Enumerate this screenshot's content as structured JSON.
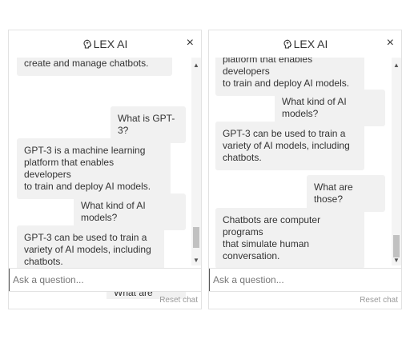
{
  "app": {
    "title": "LEX AI"
  },
  "panels": [
    {
      "messages": [
        {
          "text": "create and manage chatbots.",
          "role": "bot"
        },
        {
          "text": "What is GPT-3?",
          "role": "user"
        },
        {
          "text": "GPT-3 is a machine learning\nplatform that enables developers\nto train and deploy AI models.",
          "role": "bot"
        },
        {
          "text": "What kind of AI models?",
          "role": "user"
        },
        {
          "text": "GPT-3 can be used to train a\nvariety of AI models, including\nchatbots.",
          "role": "bot"
        },
        {
          "text": "What are those?",
          "role": "user"
        }
      ],
      "input_placeholder": "Ask a question...",
      "reset_label": "Reset chat"
    },
    {
      "messages": [
        {
          "text": "platform that enables developers\nto train and deploy AI models.",
          "role": "bot"
        },
        {
          "text": "What kind of AI models?",
          "role": "user"
        },
        {
          "text": "GPT-3 can be used to train a\nvariety of AI models, including\nchatbots.",
          "role": "bot"
        },
        {
          "text": "What are those?",
          "role": "user"
        },
        {
          "text": "Chatbots are computer programs\nthat simulate human\nconversation.",
          "role": "bot"
        }
      ],
      "input_placeholder": "Ask a question...",
      "reset_label": "Reset chat"
    }
  ],
  "icons": {
    "logo": "brain-icon",
    "close": "close-icon"
  },
  "colors": {
    "bubble": "#f1f1f1",
    "text": "#333333",
    "border": "#e2e2e2"
  }
}
